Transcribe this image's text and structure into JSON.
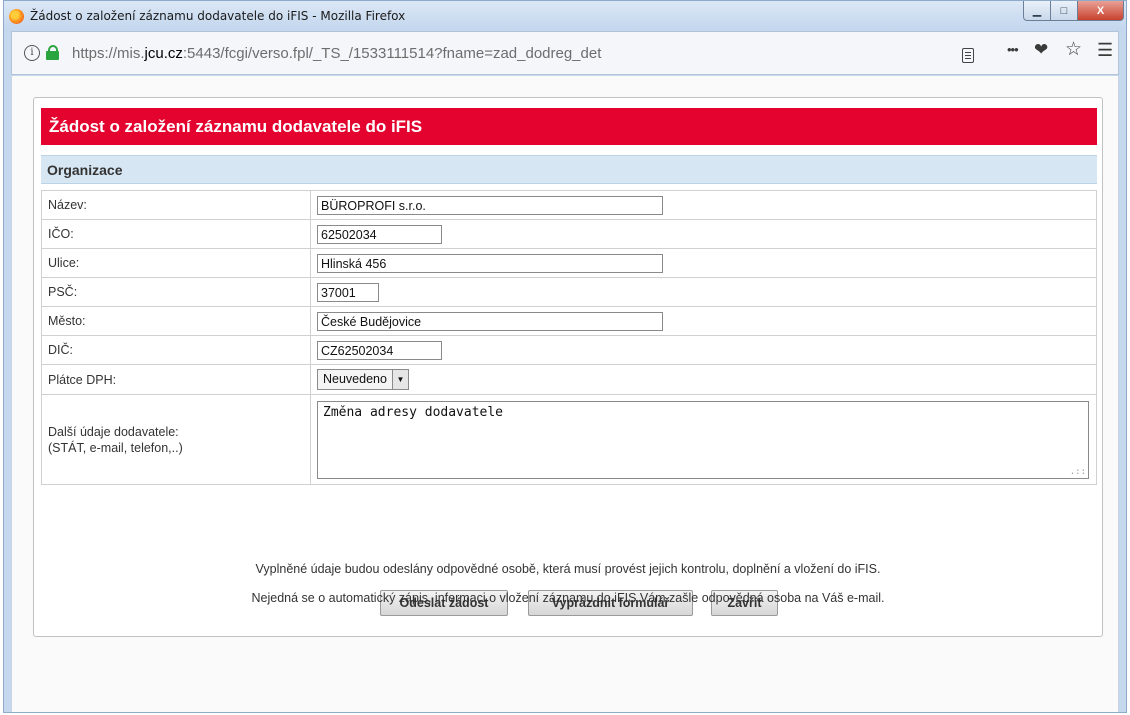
{
  "window": {
    "title": "Žádost o založení záznamu dodavatele do iFIS - Mozilla Firefox",
    "minimize_glyph": "▁",
    "maximize_glyph": "□",
    "close_glyph": "X"
  },
  "address_bar": {
    "url_prefix": "https://mis.",
    "url_domain": "jcu.cz",
    "url_rest": ":5443/fcgi/verso.fpl/_TS_/1533111514?fname=zad_dodreg_det",
    "info_glyph": "i",
    "icons": [
      "info-icon",
      "lock-icon",
      "reader-view-icon",
      "more-icon",
      "pocket-icon",
      "bookmark-star-icon",
      "menu-icon"
    ],
    "more_glyph": "•••",
    "pocket_glyph": "❤",
    "star_glyph": "☆",
    "menu_glyph": "☰"
  },
  "form": {
    "header": "Žádost o založení záznamu dodavatele do iFIS",
    "section_title": "Organizace",
    "fields": {
      "nazev": {
        "label": "Název:",
        "value": "BÜROPROFI s.r.o."
      },
      "ico": {
        "label": "IČO:",
        "value": "62502034"
      },
      "ulice": {
        "label": "Ulice:",
        "value": "Hlinská 456"
      },
      "psc": {
        "label": "PSČ:",
        "value": "37001"
      },
      "mesto": {
        "label": "Město:",
        "value": "České Budějovice"
      },
      "dic": {
        "label": "DIČ:",
        "value": "CZ62502034"
      },
      "platce_dph": {
        "label": "Plátce DPH:",
        "value": "Neuvedeno",
        "arrow_glyph": "▼"
      },
      "dalsi_udaje": {
        "label_line1": "Další údaje dodavatele:",
        "label_line2": "(STÁT, e-mail, telefon,..)",
        "value": "Změna adresy dodavatele",
        "grip_glyph": ".::"
      }
    },
    "buttons": {
      "submit": "Odeslat žádost",
      "clear": "Vyprázdnit formulář",
      "close": "Zavřít"
    },
    "notes": {
      "line1": "Vyplněné údaje budou odeslány odpovědné osobě, která musí provést jejich kontrolu, doplnění a vložení do iFIS.",
      "line2": "Nejedná se o automatický zápis, informaci o vložení záznamu do iFIS Vám zašle odpovědná osoba na Váš e-mail."
    }
  },
  "colors": {
    "header_red": "#e4032e",
    "section_blue": "#d6e6f3",
    "lock_green": "#2aa43c"
  }
}
